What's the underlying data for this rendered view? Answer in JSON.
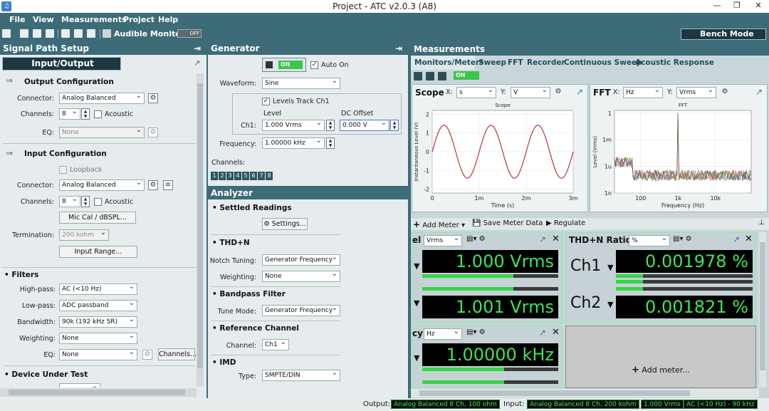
{
  "window": {
    "title": "Project - ATC v2.0.3 (A8)"
  },
  "menu": [
    "File",
    "View",
    "Measurements",
    "Project",
    "Help"
  ],
  "toolbar": {
    "audible_label": "Audible Monitor",
    "audible_state": "OFF",
    "mode": "Bench Mode"
  },
  "signal_path": {
    "title": "Signal Path Setup",
    "mode": "Input/Output",
    "output": {
      "title": "Output Configuration",
      "connector_label": "Connector:",
      "connector": "Analog Balanced",
      "channels_label": "Channels:",
      "channels": "8",
      "acoustic": "Acoustic",
      "eq_label": "EQ:",
      "eq": "None"
    },
    "input": {
      "title": "Input Configuration",
      "loopback": "Loopback",
      "connector_label": "Connector:",
      "connector": "Analog Balanced",
      "channels_label": "Channels:",
      "channels": "8",
      "acoustic": "Acoustic",
      "miccal": "Mic Cal / dBSPL...",
      "termination_label": "Termination:",
      "termination": "200 kohm",
      "input_range": "Input Range..."
    },
    "filters": {
      "title": "Filters",
      "highpass_label": "High-pass:",
      "highpass": "AC (<10 Hz)",
      "lowpass_label": "Low-pass:",
      "lowpass": "ADC passband",
      "bandwidth_label": "Bandwidth:",
      "bandwidth": "90k (192 kHz SR)",
      "weighting_label": "Weighting:",
      "weighting": "None",
      "eq_label": "EQ:",
      "eq": "None",
      "channels_btn": "Channels..."
    },
    "dut": {
      "title": "Device Under Test"
    }
  },
  "generator": {
    "title": "Generator",
    "on_label": "ON",
    "auto_on": "Auto On",
    "waveform_label": "Waveform:",
    "waveform": "Sine",
    "levels_track": "Levels Track Ch1",
    "level_hdr": "Level",
    "dc_offset_hdr": "DC Offset",
    "ch1_label": "Ch1:",
    "ch1_level": "1.000 Vrms",
    "dc_offset": "0.000 V",
    "frequency_label": "Frequency:",
    "frequency": "1.00000 kHz",
    "channels_label": "Channels:",
    "channel_numbers": [
      "1",
      "2",
      "3",
      "4",
      "5",
      "6",
      "7",
      "8"
    ]
  },
  "analyzer": {
    "title": "Analyzer",
    "settled": {
      "title": "Settled Readings",
      "settings_btn": "Settings..."
    },
    "thdn": {
      "title": "THD+N",
      "notch_label": "Notch Tuning:",
      "notch": "Generator Frequency",
      "weighting_label": "Weighting:",
      "weighting": "None"
    },
    "bandpass": {
      "title": "Bandpass Filter",
      "tune_label": "Tune Mode:",
      "tune": "Generator Frequency"
    },
    "reference": {
      "title": "Reference Channel",
      "channel_label": "Channel:",
      "channel": "Ch1"
    },
    "imd": {
      "title": "IMD",
      "type_label": "Type:",
      "type": "SMPTE/DIN"
    }
  },
  "measurements": {
    "title": "Measurements",
    "tabs": [
      "Monitors/Meters",
      "Sweep",
      "FFT",
      "Recorder",
      "Continuous Sweep",
      "Acoustic Response"
    ],
    "on_label": "ON",
    "scope": {
      "title": "Scope",
      "x_label": "X:",
      "x_unit": "s",
      "y_label": "Y:",
      "y_unit": "V",
      "plot_title": "Scope",
      "xlabel": "Time (s)",
      "ylabel": "Instantaneous Level (V)",
      "xticks": [
        "0",
        "1m",
        "2m",
        "3m"
      ],
      "yticks": [
        "2",
        "1",
        "0",
        "-1",
        "-2"
      ]
    },
    "fft": {
      "title": "FFT",
      "x_label": "X:",
      "x_unit": "Hz",
      "y_label": "Y:",
      "y_unit": "Vrms",
      "plot_title": "FFT",
      "xlabel": "Frequency (Hz)",
      "ylabel": "Level (Vrms)",
      "xticks": [
        "100",
        "1k",
        "10k"
      ],
      "yticks": [
        "1",
        "1m",
        "1u",
        "1n"
      ]
    },
    "meter_toolbar": {
      "add_meter": "Add Meter",
      "save_data": "Save Meter Data",
      "regulate": "Regulate"
    },
    "level_meter": {
      "title_partial": "el",
      "unit": "Vrms",
      "rows": [
        {
          "value": "1.000 Vrms",
          "bar": 0.67
        },
        {
          "value": "1.001 Vrms",
          "bar": 0.67
        }
      ]
    },
    "thdn_meter": {
      "title": "THD+N Ratio",
      "unit": "%",
      "rows": [
        {
          "ch": "Ch1",
          "value": "0.001978 %",
          "bar": 0.2
        },
        {
          "ch": "Ch2",
          "value": "0.001821 %",
          "bar": 0.2
        }
      ]
    },
    "freq_meter": {
      "title_partial": "cy",
      "unit": "Hz",
      "value": "1.00000 kHz",
      "bar": 0.6
    },
    "add_meter_placeholder": "Add meter..."
  },
  "status": {
    "output_label": "Output:",
    "output": "Analog Balanced 8 Ch, 100 ohm",
    "input_label": "Input:",
    "input": "Analog Balanced 8 Ch, 200 kohm",
    "input_range": "1.000 Vrms",
    "input_filter": "AC (<10 Hz) - 90 kHz"
  },
  "chart_data": [
    {
      "type": "line",
      "title": "Scope",
      "xlabel": "Time (s)",
      "ylabel": "Instantaneous Level (V)",
      "xlim": [
        0,
        0.003
      ],
      "ylim": [
        -2.2,
        2.2
      ],
      "series": [
        {
          "name": "",
          "function": "1.41*sin(2*pi*1000*t)",
          "amplitude": 1.41,
          "frequency_hz": 1000
        }
      ]
    },
    {
      "type": "line",
      "title": "FFT",
      "xlabel": "Frequency (Hz)",
      "ylabel": "Level (Vrms)",
      "xscale": "log",
      "yscale": "log",
      "xlim": [
        20,
        90000
      ],
      "ylim": [
        1e-09,
        2
      ],
      "series": [
        {
          "name": "",
          "peak_frequency_hz": 1000,
          "peak_level_vrms": 1.0,
          "noise_floor_vrms": 1e-07
        }
      ]
    }
  ]
}
